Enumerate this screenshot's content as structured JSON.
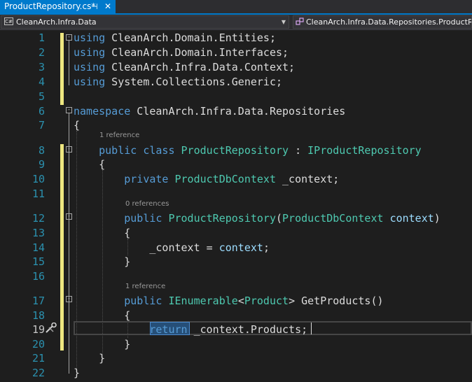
{
  "tab": {
    "title": "ProductRepository.cs*",
    "pin_glyph": "⊣",
    "close_glyph": "✕"
  },
  "nav": {
    "project_icon": "C#",
    "project": "CleanArch.Infra.Data",
    "scope": "CleanArch.Infra.Data.Repositories.ProductRepository"
  },
  "references": {
    "class": "1 reference",
    "ctor": "0 references",
    "method": "1 reference"
  },
  "icons": {
    "quick_action": "screwdriver-wrench-icon"
  },
  "colors": {
    "keyword": "#569cd6",
    "type": "#4ec9b0",
    "identifier": "#9cdcfe",
    "line_number": "#2b91af",
    "change_bar": "#eee780",
    "tab_active": "#007acc"
  },
  "lines": [
    {
      "n": "1",
      "tokens": [
        {
          "t": "using",
          "c": "kw"
        },
        {
          "t": " CleanArch.Domain.Entities;"
        }
      ]
    },
    {
      "n": "2",
      "tokens": [
        {
          "t": "using",
          "c": "kw"
        },
        {
          "t": " CleanArch.Domain.Interfaces;"
        }
      ]
    },
    {
      "n": "3",
      "tokens": [
        {
          "t": "using",
          "c": "kw"
        },
        {
          "t": " CleanArch.Infra.Data.Context;"
        }
      ]
    },
    {
      "n": "4",
      "tokens": [
        {
          "t": "using",
          "c": "kw"
        },
        {
          "t": " System.Collections.Generic;"
        }
      ]
    },
    {
      "n": "5",
      "tokens": []
    },
    {
      "n": "6",
      "tokens": [
        {
          "t": "namespace",
          "c": "kw"
        },
        {
          "t": " CleanArch.Infra.Data.Repositories"
        }
      ]
    },
    {
      "n": "7",
      "tokens": [
        {
          "t": "{"
        }
      ]
    },
    {
      "n": "8",
      "tokens": [
        {
          "t": "    "
        },
        {
          "t": "public",
          "c": "kw"
        },
        {
          "t": " "
        },
        {
          "t": "class",
          "c": "kw"
        },
        {
          "t": " "
        },
        {
          "t": "ProductRepository",
          "c": "ty"
        },
        {
          "t": " : "
        },
        {
          "t": "IProductRepository",
          "c": "ty"
        }
      ]
    },
    {
      "n": "9",
      "tokens": [
        {
          "t": "    {"
        }
      ]
    },
    {
      "n": "10",
      "tokens": [
        {
          "t": "        "
        },
        {
          "t": "private",
          "c": "kw"
        },
        {
          "t": " "
        },
        {
          "t": "ProductDbContext",
          "c": "ty"
        },
        {
          "t": " _context;"
        }
      ]
    },
    {
      "n": "11",
      "tokens": []
    },
    {
      "n": "12",
      "tokens": [
        {
          "t": "        "
        },
        {
          "t": "public",
          "c": "kw"
        },
        {
          "t": " "
        },
        {
          "t": "ProductRepository",
          "c": "ty"
        },
        {
          "t": "("
        },
        {
          "t": "ProductDbContext",
          "c": "ty"
        },
        {
          "t": " "
        },
        {
          "t": "context",
          "c": "id"
        },
        {
          "t": ")"
        }
      ]
    },
    {
      "n": "13",
      "tokens": [
        {
          "t": "        {"
        }
      ]
    },
    {
      "n": "14",
      "tokens": [
        {
          "t": "            _context = "
        },
        {
          "t": "context",
          "c": "id"
        },
        {
          "t": ";"
        }
      ]
    },
    {
      "n": "15",
      "tokens": [
        {
          "t": "        }"
        }
      ]
    },
    {
      "n": "16",
      "tokens": []
    },
    {
      "n": "17",
      "tokens": [
        {
          "t": "        "
        },
        {
          "t": "public",
          "c": "kw"
        },
        {
          "t": " "
        },
        {
          "t": "IEnumerable",
          "c": "ty"
        },
        {
          "t": "<"
        },
        {
          "t": "Product",
          "c": "ty"
        },
        {
          "t": "> GetProducts()"
        }
      ]
    },
    {
      "n": "18",
      "tokens": [
        {
          "t": "        {"
        }
      ]
    },
    {
      "n": "19",
      "tokens": [
        {
          "t": "            "
        },
        {
          "t": "return",
          "c": "kw"
        },
        {
          "t": " _context.Products;"
        }
      ]
    },
    {
      "n": "20",
      "tokens": [
        {
          "t": "        }"
        }
      ]
    },
    {
      "n": "21",
      "tokens": [
        {
          "t": "    }"
        }
      ]
    },
    {
      "n": "22",
      "tokens": [
        {
          "t": "}"
        }
      ]
    }
  ],
  "current_line": "19"
}
